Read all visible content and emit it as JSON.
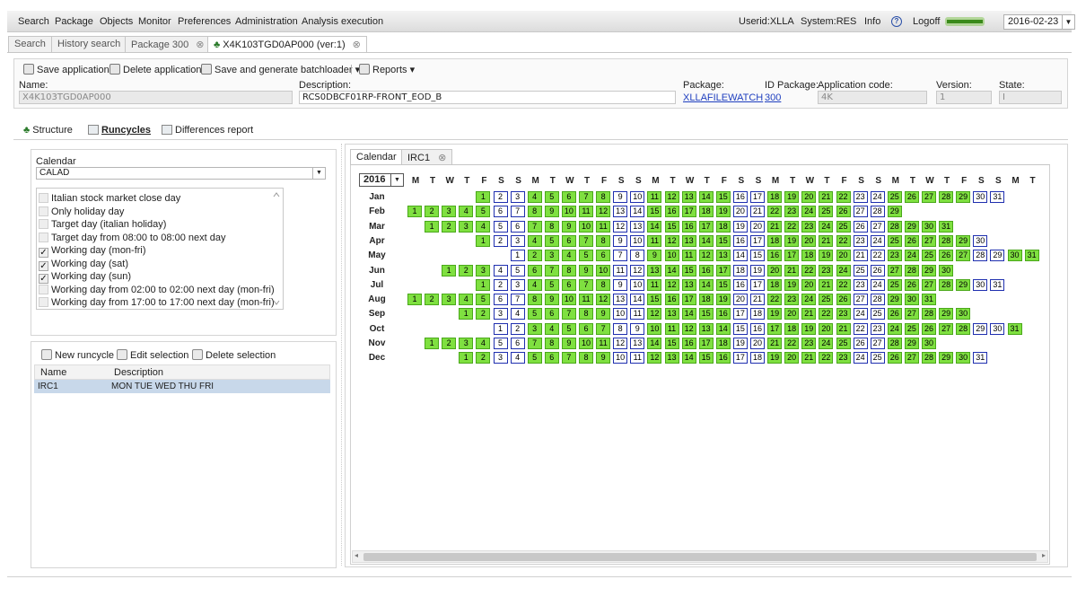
{
  "menu": {
    "items": [
      "Search",
      "Package",
      "Objects",
      "Monitor",
      "Preferences",
      "Administration",
      "Analysis execution"
    ],
    "userid": "Userid:XLLA",
    "system": "System:RES",
    "info": "Info",
    "logoff": "Logoff",
    "date": "2016-02-23"
  },
  "tabs": [
    "Search",
    "History search",
    "Package 300",
    "X4K103TGD0AP000 (ver:1)"
  ],
  "toolbar": {
    "save": "Save application",
    "delete": "Delete application",
    "save_gen": "Save and generate batchloader",
    "reports": "Reports"
  },
  "fields": {
    "name_label": "Name:",
    "name_value": "X4K103TGD0AP000",
    "desc_label": "Description:",
    "desc_value": "RCS0DBCF01RP-FRONT_EOD_B",
    "package_label": "Package:",
    "package_value": "XLLAFILEWATCH",
    "idpkg_label": "ID Package:",
    "idpkg_value": "300",
    "appcode_label": "Application code:",
    "appcode_value": "4K",
    "version_label": "Version:",
    "version_value": "1",
    "state_label": "State:",
    "state_value": "I"
  },
  "section_tabs": [
    "Structure",
    "Runcycles",
    "Differences report"
  ],
  "calendar_panel": {
    "label": "Calendar",
    "value": "CALAD",
    "day_types": [
      {
        "label": "Italian stock market close day",
        "checked": false
      },
      {
        "label": "Only holiday day",
        "checked": false
      },
      {
        "label": "Target day (italian holiday)",
        "checked": false
      },
      {
        "label": "Target day from 08:00 to 08:00 next day",
        "checked": false
      },
      {
        "label": "Working day (mon-fri)",
        "checked": true
      },
      {
        "label": "Working day (sat)",
        "checked": true
      },
      {
        "label": "Working day (sun)",
        "checked": true
      },
      {
        "label": "Working day from 02:00 to 02:00 next day (mon-fri)",
        "checked": false
      },
      {
        "label": "Working day from 17:00 to 17:00 next day (mon-fri)",
        "checked": false
      }
    ]
  },
  "runcycle_panel": {
    "new": "New runcycle",
    "edit": "Edit selection",
    "delete": "Delete selection",
    "col_name": "Name",
    "col_desc": "Description",
    "row_name": "IRC1",
    "row_desc": "MON TUE WED THU FRI"
  },
  "right_tabs": [
    "Calendar",
    "IRC1"
  ],
  "year": "2016",
  "weekdays": [
    "M",
    "T",
    "W",
    "T",
    "F",
    "S",
    "S",
    "M",
    "T",
    "W",
    "T",
    "F",
    "S",
    "S",
    "M",
    "T",
    "W",
    "T",
    "F",
    "S",
    "S",
    "M",
    "T",
    "W",
    "T",
    "F",
    "S",
    "S",
    "M",
    "T",
    "W",
    "T",
    "F",
    "S",
    "S",
    "M",
    "T"
  ],
  "months": [
    {
      "name": "Jan",
      "offset": 4,
      "days": 31
    },
    {
      "name": "Feb",
      "offset": 0,
      "days": 29
    },
    {
      "name": "Mar",
      "offset": 1,
      "days": 31
    },
    {
      "name": "Apr",
      "offset": 4,
      "days": 30
    },
    {
      "name": "May",
      "offset": 6,
      "days": 31
    },
    {
      "name": "Jun",
      "offset": 2,
      "days": 30
    },
    {
      "name": "Jul",
      "offset": 4,
      "days": 31
    },
    {
      "name": "Aug",
      "offset": 0,
      "days": 31
    },
    {
      "name": "Sep",
      "offset": 3,
      "days": 30
    },
    {
      "name": "Oct",
      "offset": 5,
      "days": 31
    },
    {
      "name": "Nov",
      "offset": 1,
      "days": 30
    },
    {
      "name": "Dec",
      "offset": 3,
      "days": 31
    }
  ],
  "colors": {
    "working_day": "#7fe040",
    "non_working_border": "#1f2faf"
  }
}
